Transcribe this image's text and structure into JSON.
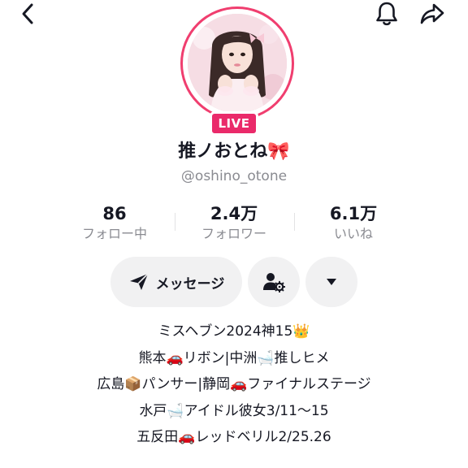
{
  "nav": {
    "back_icon": "chevron-left-icon",
    "bell_icon": "bell-icon",
    "share_icon": "share-arrow-icon"
  },
  "profile": {
    "live_label": "LIVE",
    "display_name": "推ノおとね🎀",
    "username": "@oshino_otone"
  },
  "stats": {
    "following": {
      "value": "86",
      "label": "フォロー中"
    },
    "followers": {
      "value": "2.4万",
      "label": "フォロワー"
    },
    "likes": {
      "value": "6.1万",
      "label": "いいね"
    }
  },
  "actions": {
    "message_label": "メッセージ",
    "message_icon": "send-icon",
    "add_friend_icon": "person-settings-icon",
    "more_icon": "caret-down-icon"
  },
  "bio": {
    "lines": [
      "ミスヘブン2024神15👑",
      "熊本🚗リボン|中洲🛁推しヒメ",
      "広島📦パンサー|静岡🚗ファイナルステージ",
      "水戸🛁アイドル彼女3/11〜15",
      "五反田🚗レッドベリル2/25.26"
    ]
  },
  "colors": {
    "live_badge": "#ea2a6a",
    "avatar_ring": "#f03e6f",
    "button_bg": "#f1f1f2",
    "secondary_text": "#8a8b91"
  }
}
